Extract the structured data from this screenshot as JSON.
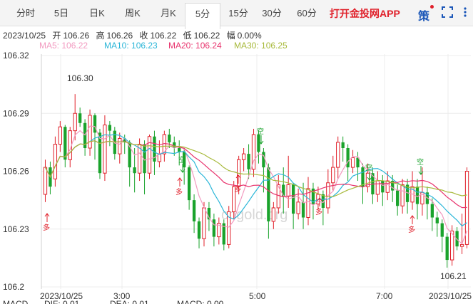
{
  "tabs": [
    {
      "label": "分时"
    },
    {
      "label": "5日"
    },
    {
      "label": "日K"
    },
    {
      "label": "周K"
    },
    {
      "label": "月K"
    },
    {
      "label": "5分",
      "active": true
    },
    {
      "label": "15分"
    },
    {
      "label": "30分"
    },
    {
      "label": "60分"
    }
  ],
  "app_link": "打开金投网APP",
  "strategy_label": "策",
  "info": {
    "date": "2023/10/25",
    "open_label": "开",
    "open": "106.26",
    "high_label": "高",
    "high": "106.26",
    "close_label": "收",
    "close": "106.22",
    "low_label": "低",
    "low": "106.22",
    "amp_label": "幅",
    "amp": "0.00%"
  },
  "ma": [
    {
      "label": "MA5: 106.22",
      "color": "#f29ac0"
    },
    {
      "label": "MA10: 106.23",
      "color": "#2bb6d8"
    },
    {
      "label": "MA20: 106.24",
      "color": "#e8336d"
    },
    {
      "label": "MA30: 106.25",
      "color": "#a7b93a"
    }
  ],
  "bottom_labels": [
    "MACD",
    "DIF: 0.01",
    "DEA: 0.01",
    "MACD: 0.00"
  ],
  "watermark": "cngold.org",
  "colors": {
    "up": "#e0202a",
    "down": "#1aa32c",
    "grid": "#ececec"
  },
  "chart_data": {
    "type": "candlestick",
    "y_ticks": [
      "106.32",
      "106.29",
      "106.26",
      "106.23",
      "106.2"
    ],
    "ylim": [
      106.2,
      106.32
    ],
    "x_ticks": [
      "2023/10/25",
      "3:00",
      "5:00",
      "7:00",
      "2023/10/25"
    ],
    "max_label": "106.30",
    "min_label": "106.21",
    "buy_marker": "多",
    "sell_marker": "空",
    "candles": [
      [
        106.248,
        106.262,
        106.244,
        106.266
      ],
      [
        106.262,
        106.252,
        106.248,
        106.265
      ],
      [
        106.256,
        106.274,
        106.252,
        106.278
      ],
      [
        106.274,
        106.283,
        106.27,
        106.286
      ],
      [
        106.283,
        106.266,
        106.262,
        106.284
      ],
      [
        106.266,
        106.281,
        106.262,
        106.283
      ],
      [
        106.281,
        106.29,
        106.276,
        106.3
      ],
      [
        106.29,
        106.285,
        106.283,
        106.293
      ],
      [
        106.285,
        106.272,
        106.268,
        106.287
      ],
      [
        106.272,
        106.289,
        106.268,
        106.292
      ],
      [
        106.289,
        106.28,
        106.266,
        106.29
      ],
      [
        106.28,
        106.259,
        106.256,
        106.282
      ],
      [
        106.259,
        106.284,
        106.255,
        106.289
      ],
      [
        106.284,
        106.281,
        106.273,
        106.286
      ],
      [
        106.281,
        106.269,
        106.266,
        106.283
      ],
      [
        106.269,
        106.277,
        106.264,
        106.28
      ],
      [
        106.277,
        106.275,
        106.269,
        106.279
      ],
      [
        106.275,
        106.262,
        106.252,
        106.276
      ],
      [
        106.262,
        106.259,
        106.249,
        106.272
      ],
      [
        106.259,
        106.274,
        106.255,
        106.277
      ],
      [
        106.274,
        106.259,
        106.248,
        106.276
      ],
      [
        106.259,
        106.278,
        106.256,
        106.279
      ],
      [
        106.278,
        106.265,
        106.258,
        106.281
      ],
      [
        106.265,
        106.269,
        106.262,
        106.276
      ],
      [
        106.269,
        106.279,
        106.265,
        106.281
      ],
      [
        106.279,
        106.275,
        106.272,
        106.282
      ],
      [
        106.275,
        106.272,
        106.268,
        106.278
      ],
      [
        106.272,
        106.27,
        106.263,
        106.276
      ],
      [
        106.27,
        106.262,
        106.253,
        106.272
      ],
      [
        106.262,
        106.245,
        106.24,
        106.263
      ],
      [
        106.245,
        106.234,
        106.228,
        106.248
      ],
      [
        106.234,
        106.225,
        106.22,
        106.236
      ],
      [
        106.225,
        106.241,
        106.221,
        106.244
      ],
      [
        106.241,
        106.235,
        106.229,
        106.244
      ],
      [
        106.235,
        106.226,
        106.221,
        106.238
      ],
      [
        106.226,
        106.233,
        106.222,
        106.236
      ],
      [
        106.233,
        106.222,
        106.219,
        106.235
      ],
      [
        106.222,
        106.239,
        106.22,
        106.242
      ],
      [
        106.239,
        106.252,
        106.235,
        106.255
      ],
      [
        106.252,
        106.266,
        106.248,
        106.268
      ],
      [
        106.266,
        106.269,
        106.26,
        106.272
      ],
      [
        106.269,
        106.261,
        106.256,
        106.274
      ],
      [
        106.261,
        106.279,
        106.257,
        106.282
      ],
      [
        106.279,
        106.27,
        106.264,
        106.281
      ],
      [
        106.27,
        106.262,
        106.249,
        106.272
      ],
      [
        106.262,
        106.234,
        106.225,
        106.264
      ],
      [
        106.234,
        106.241,
        106.23,
        106.244
      ],
      [
        106.241,
        106.253,
        106.238,
        106.258
      ],
      [
        106.253,
        106.247,
        106.238,
        106.262
      ],
      [
        106.247,
        106.253,
        106.241,
        106.268
      ],
      [
        106.253,
        106.238,
        106.23,
        106.254
      ],
      [
        106.238,
        106.244,
        106.235,
        106.251
      ],
      [
        106.244,
        106.236,
        106.23,
        106.254
      ],
      [
        106.236,
        106.251,
        106.232,
        106.257
      ],
      [
        106.251,
        106.243,
        106.235,
        106.254
      ],
      [
        106.243,
        106.248,
        106.24,
        106.252
      ],
      [
        106.248,
        106.241,
        106.232,
        106.25
      ],
      [
        106.241,
        106.254,
        106.238,
        106.261
      ],
      [
        106.254,
        106.262,
        106.25,
        106.268
      ],
      [
        106.262,
        106.275,
        106.256,
        106.278
      ],
      [
        106.275,
        106.272,
        106.265,
        106.278
      ],
      [
        106.272,
        106.262,
        106.255,
        106.274
      ],
      [
        106.262,
        106.267,
        106.259,
        106.271
      ],
      [
        106.267,
        106.262,
        106.255,
        106.27
      ],
      [
        106.262,
        106.252,
        106.243,
        106.264
      ],
      [
        106.252,
        106.259,
        106.249,
        106.264
      ],
      [
        106.259,
        106.248,
        106.243,
        106.262
      ],
      [
        106.248,
        106.255,
        106.244,
        106.26
      ],
      [
        106.255,
        106.249,
        106.242,
        106.258
      ],
      [
        106.249,
        106.255,
        106.245,
        106.26
      ],
      [
        106.255,
        106.25,
        106.244,
        106.258
      ],
      [
        106.25,
        106.242,
        106.237,
        106.253
      ],
      [
        106.242,
        106.253,
        106.238,
        106.256
      ],
      [
        106.253,
        106.244,
        106.238,
        106.256
      ],
      [
        106.244,
        106.252,
        106.24,
        106.26
      ],
      [
        106.252,
        106.243,
        106.235,
        106.256
      ],
      [
        106.243,
        106.249,
        106.237,
        106.262
      ],
      [
        106.249,
        106.243,
        106.235,
        106.252
      ],
      [
        106.243,
        106.236,
        106.229,
        106.246
      ],
      [
        106.236,
        106.233,
        106.226,
        106.239
      ],
      [
        106.233,
        106.226,
        106.218,
        106.235
      ],
      [
        106.226,
        106.214,
        106.21,
        106.228
      ],
      [
        106.214,
        106.229,
        106.211,
        106.232
      ],
      [
        106.229,
        106.221,
        106.219,
        106.231
      ],
      [
        106.221,
        106.222,
        106.217,
        106.238
      ],
      [
        106.222,
        106.26,
        106.22,
        106.262
      ]
    ]
  }
}
